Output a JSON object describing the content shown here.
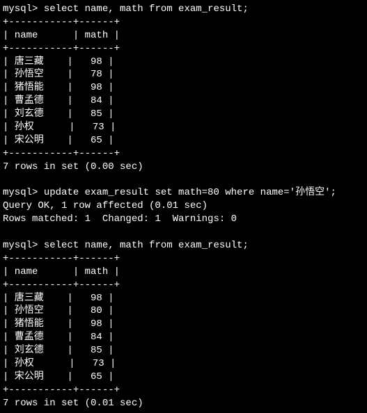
{
  "query1": {
    "prompt": "mysql> ",
    "sql": "select name, math from exam_result;",
    "border": "+-----------+------+",
    "header": "| name      | math |",
    "rows": [
      "| 唐三藏    |   98 |",
      "| 孙悟空    |   78 |",
      "| 猪悟能    |   98 |",
      "| 曹孟德    |   84 |",
      "| 刘玄德    |   85 |",
      "| 孙权      |   73 |",
      "| 宋公明    |   65 |"
    ],
    "footer": "7 rows in set (0.00 sec)"
  },
  "blank1": " ",
  "query2": {
    "prompt": "mysql> ",
    "sql": "update exam_result set math=80 where name='孙悟空';",
    "result1": "Query OK, 1 row affected (0.01 sec)",
    "result2": "Rows matched: 1  Changed: 1  Warnings: 0"
  },
  "blank2": " ",
  "query3": {
    "prompt": "mysql> ",
    "sql": "select name, math from exam_result;",
    "border": "+-----------+------+",
    "header": "| name      | math |",
    "rows": [
      "| 唐三藏    |   98 |",
      "| 孙悟空    |   80 |",
      "| 猪悟能    |   98 |",
      "| 曹孟德    |   84 |",
      "| 刘玄德    |   85 |",
      "| 孙权      |   73 |",
      "| 宋公明    |   65 |"
    ],
    "footer": "7 rows in set (0.01 sec)"
  }
}
